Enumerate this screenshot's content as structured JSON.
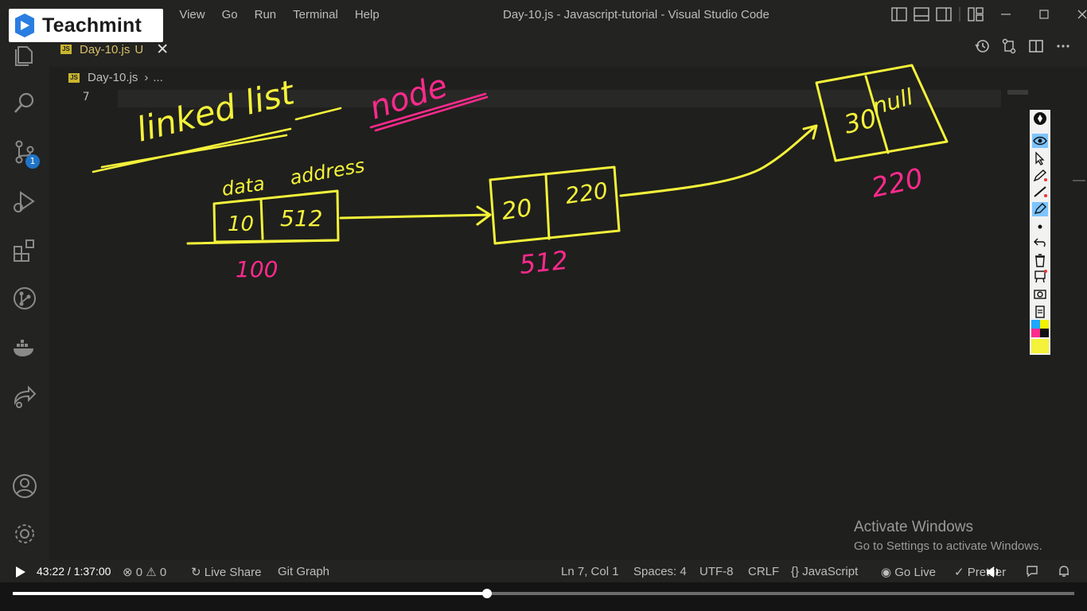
{
  "logo": {
    "text": "Teachmint"
  },
  "menu": {
    "partial_item": "n",
    "items": [
      "View",
      "Go",
      "Run",
      "Terminal",
      "Help"
    ]
  },
  "window_title": "Day-10.js - Javascript-tutorial - Visual Studio Code",
  "tab": {
    "icon_label": "JS",
    "name": "Day-10.js",
    "status": "U"
  },
  "breadcrumb": {
    "file": "Day-10.js",
    "more": "..."
  },
  "editor": {
    "line_number": "7"
  },
  "source_control_badge": "1",
  "annotations": {
    "heading_1": "linked list",
    "heading_2": "node",
    "node1": {
      "label_data": "data",
      "label_address": "address",
      "data": "10",
      "next": "512",
      "address": "100"
    },
    "node2": {
      "data": "20",
      "next": "220",
      "address": "512"
    },
    "node3": {
      "data": "30",
      "next": "null",
      "address": "220"
    },
    "colors": {
      "yellow": "#f4f23a",
      "pink": "#ff2a8c"
    }
  },
  "activate_windows": {
    "title": "Activate Windows",
    "subtitle": "Go to Settings to activate Windows."
  },
  "statusbar": {
    "errors": "0",
    "warnings": "0",
    "live_share": "Live Share",
    "git_graph": "Git Graph",
    "position": "Ln 7, Col 1",
    "spaces": "Spaces: 4",
    "encoding": "UTF-8",
    "eol": "CRLF",
    "language": "JavaScript",
    "go_live": "Go Live",
    "prettier": "Prettier"
  },
  "video": {
    "time": "43:22 / 1:37:00",
    "progress": 0.447
  }
}
